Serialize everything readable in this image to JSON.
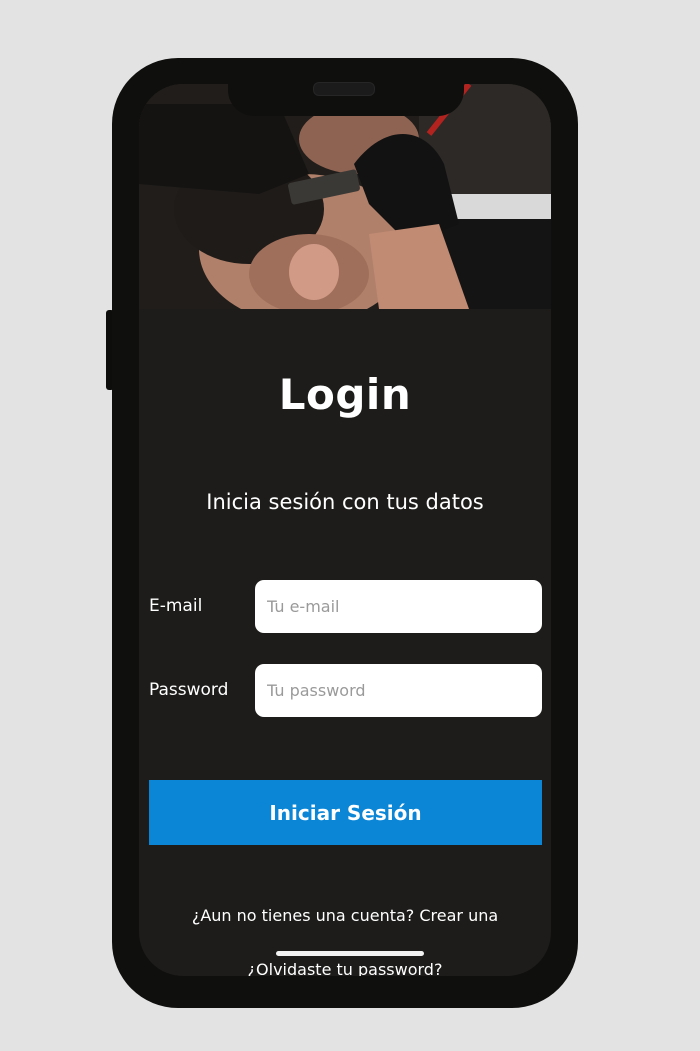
{
  "login": {
    "title": "Login",
    "subtitle": "Inicia sesión con tus datos",
    "email": {
      "label": "E-mail",
      "placeholder": "Tu e-mail",
      "value": ""
    },
    "password": {
      "label": "Password",
      "placeholder": "Tu password",
      "value": ""
    },
    "submit_label": "Iniciar Sesión",
    "create_account_text": "¿Aun no tienes una cuenta? Crear una",
    "forgot_password_text": "¿Olvidaste tu password?"
  },
  "colors": {
    "background": "#e3e3e3",
    "screen": "#1d1c1a",
    "primary_button": "#0b86d6",
    "text": "#ffffff"
  }
}
